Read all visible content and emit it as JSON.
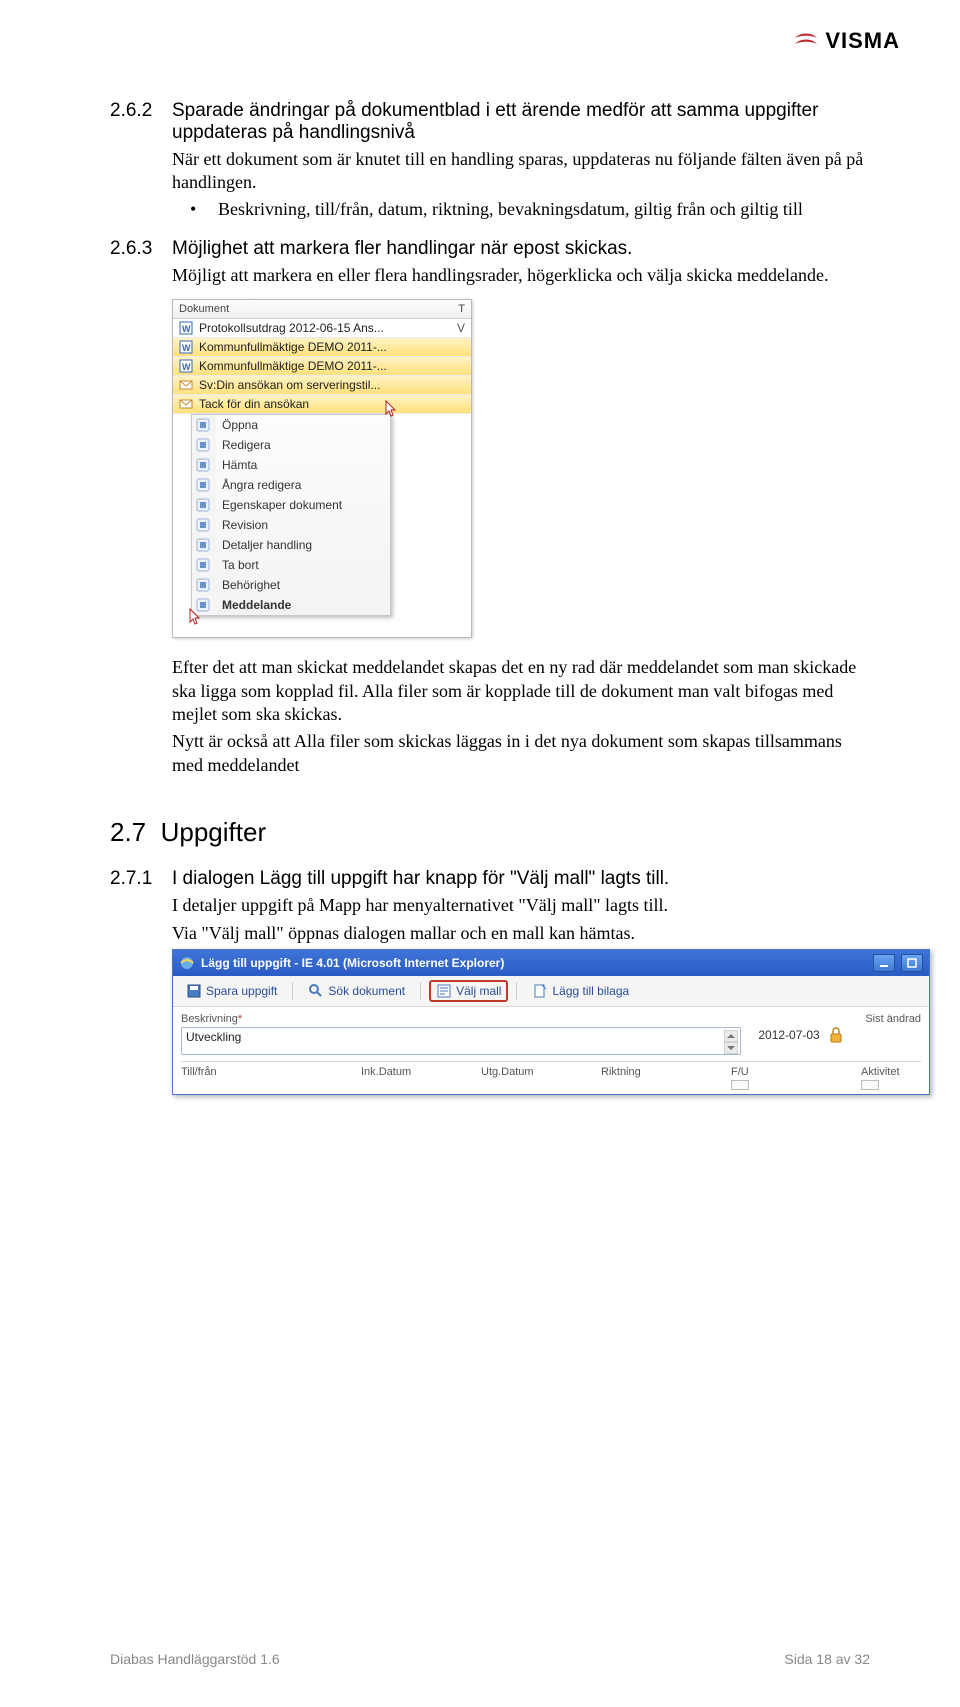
{
  "brand": "VISMA",
  "sec262": {
    "num": "2.6.2",
    "title": "Sparade ändringar på dokumentblad i ett ärende medför att samma uppgifter uppdateras på handlingsnivå",
    "p1": "När ett dokument som är knutet till en handling sparas, uppdateras nu följande fälten även på på handlingen.",
    "bullet": "Beskrivning, till/från, datum, riktning, bevakningsdatum, giltig från och giltig till"
  },
  "sec263": {
    "num": "2.6.3",
    "title": "Möjlighet att markera fler handlingar när epost skickas.",
    "p1": "Möjligt att markera en eller flera handlingsrader, högerklicka och välja skicka meddelande.",
    "p2": "Efter det att man skickat meddelandet skapas det en ny rad där meddelandet som man skickade ska ligga som kopplad fil. Alla filer som är kopplade till de dokument man valt bifogas med mejlet som ska skickas.",
    "p3": "Nytt är också att Alla filer som skickas läggas in i det nya dokument som skapas tillsammans med meddelandet"
  },
  "sec27": {
    "num": "2.7",
    "title": "Uppgifter"
  },
  "sec271": {
    "num": "2.7.1",
    "title": "I dialogen Lägg till uppgift har knapp för \"Välj mall\" lagts till.",
    "p1": "I detaljer uppgift på Mapp har menyalternativet \"Välj mall\" lagts till.",
    "p2": "Via \"Välj mall\" öppnas dialogen mallar och en mall kan hämtas."
  },
  "ss1": {
    "head": {
      "c1": "Dokument",
      "c2": "T"
    },
    "docs": [
      {
        "name": "Protokollsutdrag 2012-06-15 Ans...",
        "t": "V",
        "icon": "word"
      },
      {
        "name": "Kommunfullmäktige DEMO 2011-...",
        "t": "",
        "icon": "word",
        "sel": true
      },
      {
        "name": "Kommunfullmäktige DEMO 2011-...",
        "t": "",
        "icon": "word",
        "sel": true
      },
      {
        "name": "Sv:Din ansökan om serveringstil...",
        "t": "",
        "icon": "mail",
        "sel": true
      },
      {
        "name": "Tack för din ansökan",
        "t": "",
        "icon": "mail",
        "sel": true
      }
    ],
    "ctx": [
      {
        "label": "Öppna",
        "icon": "open"
      },
      {
        "label": "Redigera",
        "icon": "edit"
      },
      {
        "label": "Hämta",
        "icon": "download"
      },
      {
        "label": "Ångra redigera",
        "icon": "undo"
      },
      {
        "label": "Egenskaper dokument",
        "icon": "props"
      },
      {
        "label": "Revision",
        "icon": "rev"
      },
      {
        "label": "Detaljer handling",
        "icon": "details"
      },
      {
        "label": "Ta bort",
        "icon": "delete"
      },
      {
        "label": "Behörighet",
        "icon": "perm"
      },
      {
        "label": "Meddelande",
        "icon": "msg",
        "bold": true
      }
    ]
  },
  "ss2": {
    "title": "Lägg till uppgift - IE 4.01 (Microsoft Internet Explorer)",
    "toolbar": [
      {
        "label": "Spara uppgift",
        "icon": "save"
      },
      {
        "label": "Sök dokument",
        "icon": "search"
      },
      {
        "label": "Välj mall",
        "icon": "template",
        "highlight": true
      },
      {
        "label": "Lägg till bilaga",
        "icon": "attach"
      }
    ],
    "desc_label": "Beskrivning",
    "desc_value": "Utveckling",
    "sist_label": "Sist ändrad",
    "sist_value": "2012-07-03",
    "cols": {
      "tillfran": "Till/från",
      "inkdatum": "Ink.Datum",
      "utgdatum": "Utg.Datum",
      "riktning": "Riktning",
      "fu": "F/U",
      "aktivitet": "Aktivitet"
    }
  },
  "footer": {
    "left": "Diabas Handläggarstöd 1.6",
    "right": "Sida 18 av 32"
  }
}
